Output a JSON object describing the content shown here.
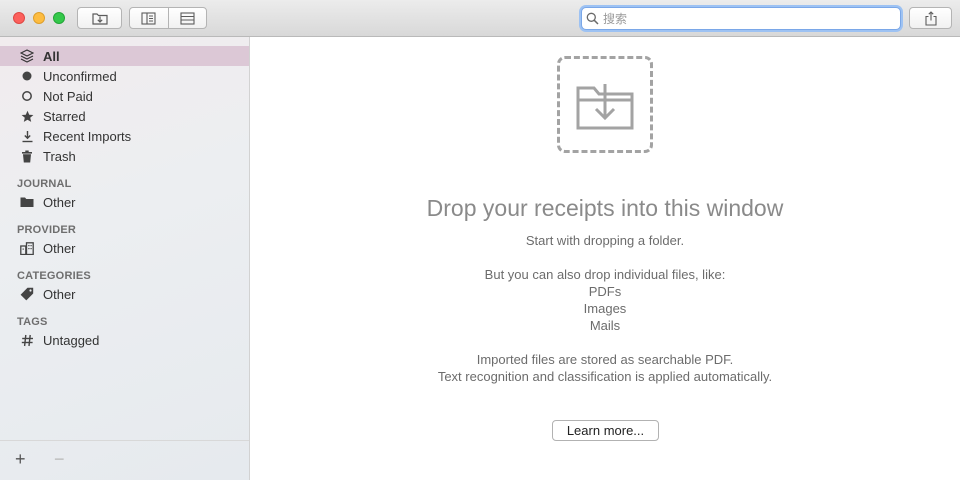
{
  "toolbar": {
    "search_placeholder": "搜索"
  },
  "sidebar": {
    "items": [
      {
        "label": "All",
        "icon": "stack-icon",
        "selected": true
      },
      {
        "label": "Unconfirmed",
        "icon": "filled-dot-icon"
      },
      {
        "label": "Not Paid",
        "icon": "hollow-circle-icon"
      },
      {
        "label": "Starred",
        "icon": "star-icon"
      },
      {
        "label": "Recent Imports",
        "icon": "download-icon"
      },
      {
        "label": "Trash",
        "icon": "trash-icon"
      }
    ],
    "sections": [
      {
        "title": "JOURNAL",
        "item": {
          "label": "Other",
          "icon": "folder-icon"
        }
      },
      {
        "title": "PROVIDER",
        "item": {
          "label": "Other",
          "icon": "building-icon"
        }
      },
      {
        "title": "CATEGORIES",
        "item": {
          "label": "Other",
          "icon": "tag-icon"
        }
      },
      {
        "title": "TAGS",
        "item": {
          "label": "Untagged",
          "icon": "hashtag-icon"
        }
      }
    ],
    "footer": {
      "add": "+",
      "remove": "−"
    }
  },
  "main": {
    "headline": "Drop your receipts into this window",
    "start_hint": "Start with dropping a folder.",
    "also_intro": "But you can also drop individual files, like:",
    "file_types": [
      "PDFs",
      "Images",
      "Mails"
    ],
    "info_line1": "Imported files are stored as searchable PDF.",
    "info_line2": "Text recognition and classification is applied automatically.",
    "learn_more": "Learn more..."
  },
  "colors": {
    "selection": "#dcc8d6",
    "search_focus": "#9dc2f3"
  }
}
